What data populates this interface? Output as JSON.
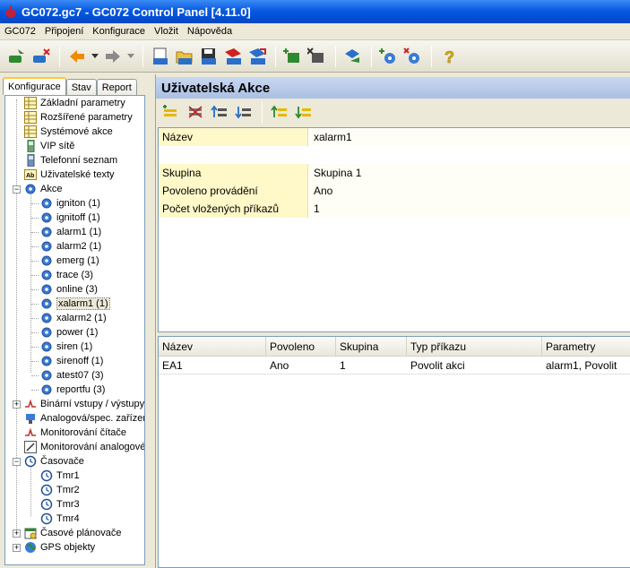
{
  "window": {
    "title": "GC072.gc7 - GC072 Control Panel [4.11.0]"
  },
  "menu": [
    "GC072",
    "Připojení",
    "Konfigurace",
    "Vložit",
    "Nápověda"
  ],
  "left_tabs": [
    "Konfigurace",
    "Stav",
    "Report"
  ],
  "tree": {
    "config": [
      "Základní parametry",
      "Rozšířené parametry",
      "Systémové akce",
      "VIP sítě",
      "Telefonní seznam",
      "Uživatelské texty"
    ],
    "akce_label": "Akce",
    "akce": [
      "igniton (1)",
      "ignitoff (1)",
      "alarm1 (1)",
      "alarm2 (1)",
      "emerg (1)",
      "trace (3)",
      "online (3)",
      "xalarm1 (1)",
      "xalarm2 (1)",
      "power (1)",
      "siren (1)",
      "sirenoff (1)",
      "atest07 (3)",
      "reportfu (3)"
    ],
    "binary": "Binární vstupy / výstupy",
    "analog_dev": "Analogová/spec. zařízení",
    "counter": "Monitorování čítače",
    "analog_mon": "Monitorování analogové",
    "timers_label": "Časovače",
    "timers": [
      "Tmr1",
      "Tmr2",
      "Tmr3",
      "Tmr4"
    ],
    "scheduler": "Časové plánovače",
    "gps": "GPS objekty"
  },
  "right": {
    "title": "Uživatelská Akce",
    "props": {
      "name_label": "Název",
      "name_value": "xalarm1",
      "group_label": "Skupina",
      "group_value": "Skupina 1",
      "enabled_label": "Povoleno provádění",
      "enabled_value": "Ano",
      "count_label": "Počet vložených příkazů",
      "count_value": "1"
    },
    "table": {
      "columns": [
        "Název",
        "Povoleno",
        "Skupina",
        "Typ příkazu",
        "Parametry"
      ],
      "rows": [
        [
          "EA1",
          "Ano",
          "1",
          "Povolit akci",
          "alarm1, Povolit"
        ]
      ]
    }
  },
  "colors": {
    "title_bar": "#0a5ae0",
    "panel_header": "#b8cbea",
    "prop_label_bg": "#fff8c8",
    "gear_icon": "#3a7bd5"
  }
}
